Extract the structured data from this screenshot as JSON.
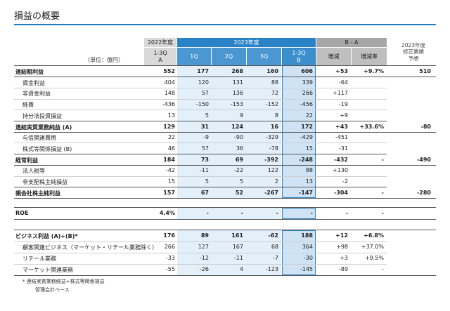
{
  "title": "損益の概要",
  "unit_label": "（単位：億円）",
  "headers": {
    "y2022": "2022年度",
    "y2022_sub": "1-3Q",
    "y2022_sub2": "A",
    "y2023": "2023年度",
    "q1": "1Q",
    "q2": "2Q",
    "q3": "3Q",
    "b_sub": "1-3Q",
    "b_sub2": "B",
    "ba": "B - A",
    "diff": "増減",
    "rate": "増減率",
    "fc1": "2023年度",
    "fc2": "修正業績",
    "fc3": "予想"
  },
  "rows": [
    {
      "label": "連結粗利益",
      "bold": true,
      "a": "552",
      "q1": "177",
      "q2": "268",
      "q3": "160",
      "b": "606",
      "diff": "+53",
      "rate": "+9.7%",
      "fc": "510"
    },
    {
      "label": "資金利益",
      "bold": false,
      "a": "404",
      "q1": "120",
      "q2": "131",
      "q3": "88",
      "b": "339",
      "diff": "-64",
      "rate": "",
      "fc": ""
    },
    {
      "label": "非資金利益",
      "bold": false,
      "a": "148",
      "q1": "57",
      "q2": "136",
      "q3": "72",
      "b": "266",
      "diff": "+117",
      "rate": "",
      "fc": ""
    },
    {
      "label": "経費",
      "bold": false,
      "a": "-436",
      "q1": "-150",
      "q2": "-153",
      "q3": "-152",
      "b": "-456",
      "diff": "-19",
      "rate": "",
      "fc": ""
    },
    {
      "label": "持分法投資損益",
      "bold": false,
      "a": "13",
      "q1": "5",
      "q2": "9",
      "q3": "8",
      "b": "22",
      "diff": "+9",
      "rate": "",
      "fc": ""
    },
    {
      "label": "連結実質業務純益 (A)",
      "bold": true,
      "a": "129",
      "q1": "31",
      "q2": "124",
      "q3": "16",
      "b": "172",
      "diff": "+43",
      "rate": "+33.6%",
      "fc": "-80"
    },
    {
      "label": "与信関連費用",
      "bold": false,
      "a": "22",
      "q1": "-9",
      "q2": "-90",
      "q3": "-329",
      "b": "-429",
      "diff": "-451",
      "rate": "",
      "fc": ""
    },
    {
      "label": "株式等関係損益 (B)",
      "bold": false,
      "a": "46",
      "q1": "57",
      "q2": "36",
      "q3": "-78",
      "b": "15",
      "diff": "-31",
      "rate": "",
      "fc": ""
    },
    {
      "label": "経常利益",
      "bold": true,
      "a": "184",
      "q1": "73",
      "q2": "69",
      "q3": "-392",
      "b": "-248",
      "diff": "-432",
      "rate": "-",
      "fc": "-490"
    },
    {
      "label": "法人税等",
      "bold": false,
      "a": "-42",
      "q1": "-11",
      "q2": "-22",
      "q3": "122",
      "b": "88",
      "diff": "+130",
      "rate": "",
      "fc": ""
    },
    {
      "label": "非支配株主純損益",
      "bold": false,
      "a": "15",
      "q1": "5",
      "q2": "5",
      "q3": "2",
      "b": "13",
      "diff": "-2",
      "rate": "",
      "fc": ""
    },
    {
      "label": "親会社株主純利益",
      "bold": true,
      "a": "157",
      "q1": "67",
      "q2": "52",
      "q3": "-267",
      "b": "-147",
      "diff": "-304",
      "rate": "-",
      "fc": "-280"
    }
  ],
  "roe": {
    "label": "ROE",
    "a": "4.4%",
    "q1": "-",
    "q2": "-",
    "q3": "-",
    "b": "-",
    "diff": "-",
    "rate": "-",
    "fc": ""
  },
  "biz_rows": [
    {
      "label": "ビジネス利益 (A)+(B)*",
      "bold": true,
      "a": "176",
      "q1": "89",
      "q2": "161",
      "q3": "-62",
      "b": "188",
      "diff": "+12",
      "rate": "+6.8%",
      "fc": ""
    },
    {
      "label": "顧客関連ビジネス（マーケット・リテール業務除く）",
      "bold": false,
      "a": "266",
      "q1": "127",
      "q2": "167",
      "q3": "68",
      "b": "364",
      "diff": "+98",
      "rate": "+37.0%",
      "fc": ""
    },
    {
      "label": "リテール業務",
      "bold": false,
      "a": "-33",
      "q1": "-12",
      "q2": "-11",
      "q3": "-7",
      "b": "-30",
      "diff": "+3",
      "rate": "+9.5%",
      "fc": ""
    },
    {
      "label": "マーケット関連業務",
      "bold": false,
      "a": "-55",
      "q1": "-26",
      "q2": "4",
      "q3": "-123",
      "b": "-145",
      "diff": "-89",
      "rate": "-",
      "fc": ""
    }
  ],
  "notes": {
    "n1": "*  連結実質業務純益+株式等関係損益",
    "n2": "管理会計ベース"
  }
}
